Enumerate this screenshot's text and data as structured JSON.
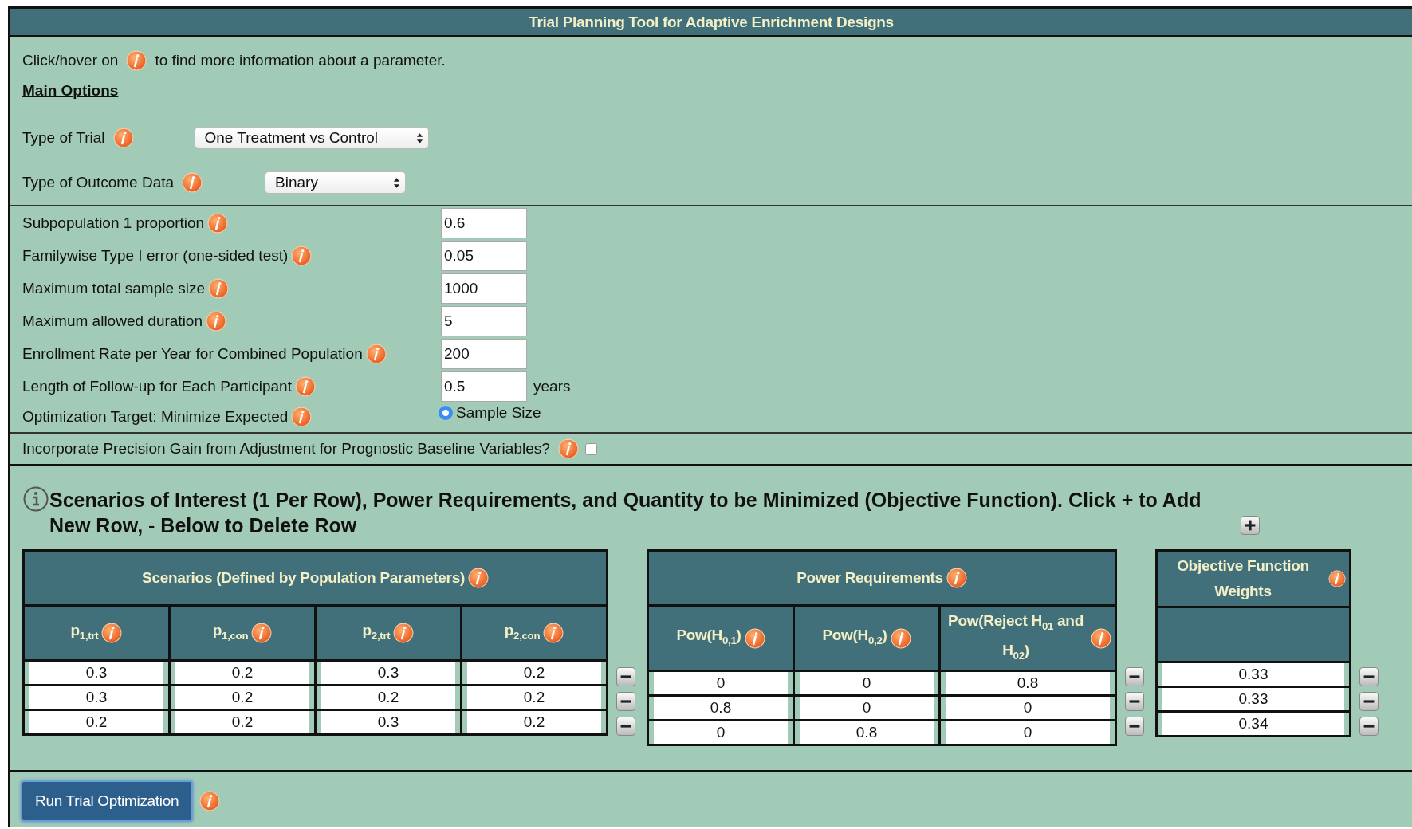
{
  "title": "Trial Planning Tool for Adaptive Enrichment Designs",
  "intro": {
    "before": "Click/hover on",
    "after": "to find more information about a parameter."
  },
  "main_options_heading": "Main Options",
  "selects": [
    {
      "label": "Type of Trial",
      "value": "One Treatment vs Control"
    },
    {
      "label": "Type of Outcome Data",
      "value": "Binary"
    }
  ],
  "parameters": [
    {
      "label": "Subpopulation 1 proportion",
      "value": "0.6"
    },
    {
      "label": "Familywise Type I error (one-sided test)",
      "value": "0.05"
    },
    {
      "label": "Maximum total sample size",
      "value": "1000"
    },
    {
      "label": "Maximum allowed duration",
      "value": "5"
    },
    {
      "label": "Enrollment Rate per Year for Combined Population",
      "value": "200"
    },
    {
      "label": "Length of Follow-up for Each Participant",
      "value": "0.5",
      "unit": "years"
    }
  ],
  "optimization": {
    "label": "Optimization Target: Minimize Expected",
    "option": "Sample Size",
    "selected": true
  },
  "precision": {
    "label": "Incorporate Precision Gain from Adjustment for Prognostic Baseline Variables?",
    "checked": false
  },
  "section_heading": "Scenarios of Interest (1 Per Row), Power Requirements, and Quantity to be Minimized (Objective Function). Click + to Add New Row, - Below to Delete Row",
  "tables": [
    {
      "title": "Scenarios (Defined by Population Parameters)",
      "columns": [
        "p$_{1,trt}$",
        "p$_{1,con}$",
        "p$_{2,trt}$",
        "p$_{2,con}$"
      ],
      "rows": [
        [
          "0.3",
          "0.2",
          "0.3",
          "0.2"
        ],
        [
          "0.3",
          "0.2",
          "0.2",
          "0.2"
        ],
        [
          "0.2",
          "0.2",
          "0.3",
          "0.2"
        ]
      ]
    },
    {
      "title": "Power Requirements",
      "columns": [
        "Pow(H$_{0,1}$)",
        "Pow(H$_{0,2}$)",
        "Pow(Reject H$_{01}$ and H$_{02}$)"
      ],
      "rows": [
        [
          "0",
          "0",
          "0.8"
        ],
        [
          "0.8",
          "0",
          "0"
        ],
        [
          "0",
          "0.8",
          "0"
        ]
      ]
    },
    {
      "title": "Objective Function Weights",
      "rows": [
        [
          "0.33"
        ],
        [
          "0.33"
        ],
        [
          "0.34"
        ]
      ]
    }
  ],
  "run_button": "Run Trial Optimization"
}
